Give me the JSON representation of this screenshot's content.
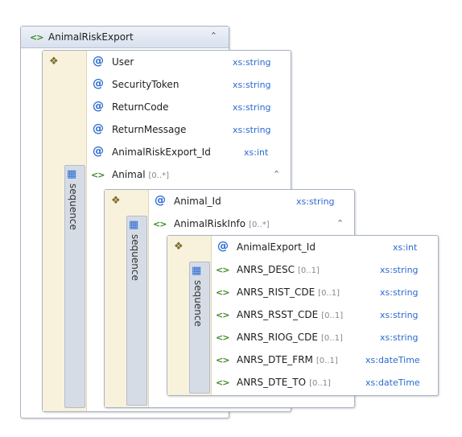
{
  "root": {
    "title": "AnimalRiskExport"
  },
  "level1": {
    "sequence_label": "sequence",
    "attributes": [
      {
        "name": "User",
        "type": "xs:string"
      },
      {
        "name": "SecurityToken",
        "type": "xs:string"
      },
      {
        "name": "ReturnCode",
        "type": "xs:string"
      },
      {
        "name": "ReturnMessage",
        "type": "xs:string"
      },
      {
        "name": "AnimalRiskExport_Id",
        "type": "xs:int"
      }
    ],
    "element": {
      "name": "Animal",
      "cardinality": "[0..*]"
    }
  },
  "level2": {
    "sequence_label": "sequence",
    "attributes": [
      {
        "name": "Animal_Id",
        "type": "xs:string"
      }
    ],
    "element": {
      "name": "AnimalRiskInfo",
      "cardinality": "[0..*]"
    }
  },
  "level3": {
    "sequence_label": "sequence",
    "attributes": [
      {
        "name": "AnimalExport_Id",
        "type": "xs:int"
      }
    ],
    "elements": [
      {
        "name": "ANRS_DESC",
        "cardinality": "[0..1]",
        "type": "xs:string"
      },
      {
        "name": "ANRS_RIST_CDE",
        "cardinality": "[0..1]",
        "type": "xs:string"
      },
      {
        "name": "ANRS_RSST_CDE",
        "cardinality": "[0..1]",
        "type": "xs:string"
      },
      {
        "name": "ANRS_RIOG_CDE",
        "cardinality": "[0..1]",
        "type": "xs:string"
      },
      {
        "name": "ANRS_DTE_FRM",
        "cardinality": "[0..1]",
        "type": "xs:dateTime"
      },
      {
        "name": "ANRS_DTE_TO",
        "cardinality": "[0..1]",
        "type": "xs:dateTime"
      }
    ]
  },
  "icons": {
    "element": "element-icon",
    "attribute": "attribute-icon",
    "complex_type": "complex-type-icon",
    "sequence": "sequence-icon",
    "collapse": "collapse-chevron-icon"
  },
  "colors": {
    "attribute": "#2a6ad1",
    "element": "#3a8a23",
    "type_text": "#2a6ad1",
    "title_bar": "#dde4ef",
    "complex_type_strip": "#f8f1dc",
    "sequence_strip": "#d6dce6",
    "border": "#a9b3c4"
  }
}
